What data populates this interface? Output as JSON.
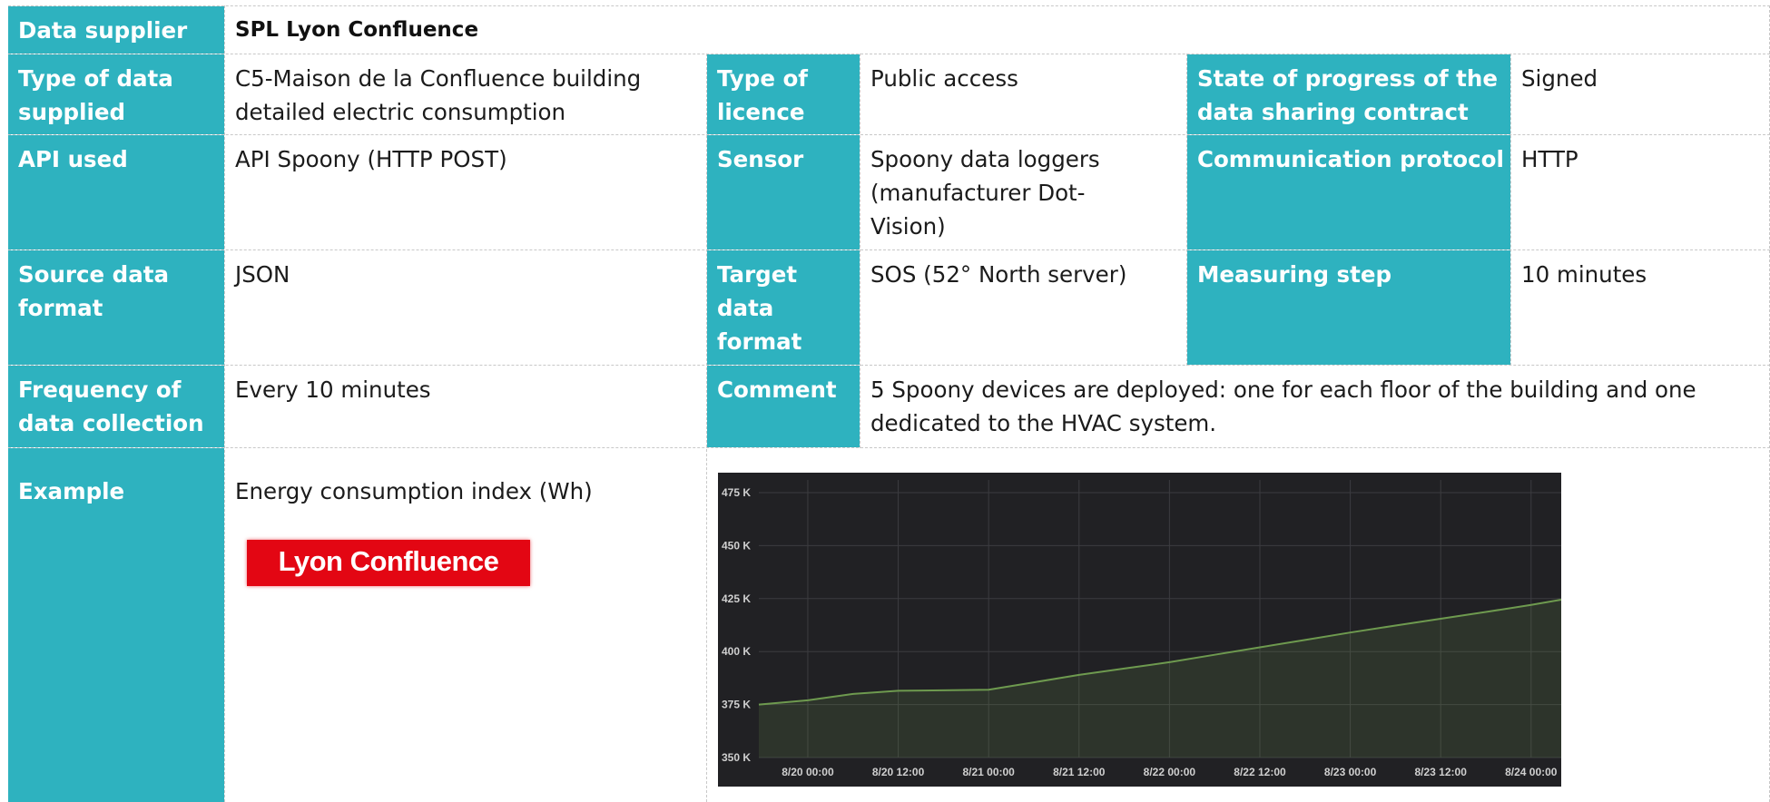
{
  "rows": {
    "data_supplier": {
      "label": "Data supplier",
      "value": "SPL Lyon Confluence"
    },
    "type_of_data": {
      "label": "Type of data supplied",
      "value": "C5-Maison de la Confluence building detailed electric consumption"
    },
    "type_of_licence": {
      "label": "Type of licence",
      "value": "Public access"
    },
    "state_of_progress": {
      "label": "State of progress of the data sharing contract",
      "value": "Signed"
    },
    "api_used": {
      "label": "API used",
      "value": "API Spoony (HTTP POST)"
    },
    "sensor": {
      "label": "Sensor",
      "value": "Spoony data loggers (manufacturer Dot-Vision)"
    },
    "communication_protocol": {
      "label": "Communication protocol",
      "value": "HTTP"
    },
    "source_data_format": {
      "label": "Source data format",
      "value": "JSON"
    },
    "target_data_format": {
      "label": "Target data format",
      "value": "SOS (52° North server)"
    },
    "measuring_step": {
      "label": "Measuring step",
      "value": "10 minutes"
    },
    "frequency": {
      "label": "Frequency of data collection",
      "value": "Every 10 minutes"
    },
    "comment": {
      "label": "Comment",
      "value": "5 Spoony devices are deployed: one for each floor of the building and one dedicated to the HVAC system."
    },
    "example": {
      "label": "Example",
      "value": "Energy consumption index (Wh)"
    }
  },
  "logo": {
    "text": "Lyon Confluence",
    "color": "#e30613"
  },
  "colors": {
    "label_bg": "#2eb2bf",
    "chart_bg": "#212124",
    "series": "#6e9a4f"
  },
  "chart_data": {
    "type": "area",
    "y_tick_labels": [
      "475 K",
      "450 K",
      "425 K",
      "400 K",
      "375 K",
      "350 K"
    ],
    "y_ticks": [
      475000,
      450000,
      425000,
      400000,
      375000,
      350000
    ],
    "ylim": [
      350000,
      475000
    ],
    "x_tick_labels": [
      "8/20 00:00",
      "8/20 12:00",
      "8/21 00:00",
      "8/21 12:00",
      "8/22 00:00",
      "8/22 12:00",
      "8/23 00:00",
      "8/23 12:00",
      "8/24 00:00"
    ],
    "x_ticks_hours": [
      0,
      12,
      24,
      36,
      48,
      60,
      72,
      84,
      96
    ],
    "xlim_hours": [
      -6.5,
      100
    ],
    "grid": true,
    "series": [
      {
        "x_hours": [
          -6.5,
          0,
          6,
          12,
          18,
          24,
          30,
          36,
          42,
          48,
          54,
          60,
          66,
          72,
          78,
          84,
          90,
          96,
          100
        ],
        "values": [
          375000,
          377000,
          380000,
          381500,
          381700,
          382000,
          385500,
          389000,
          392000,
          395000,
          398500,
          402000,
          405500,
          409000,
          412300,
          415500,
          418700,
          422000,
          424500
        ]
      }
    ]
  }
}
